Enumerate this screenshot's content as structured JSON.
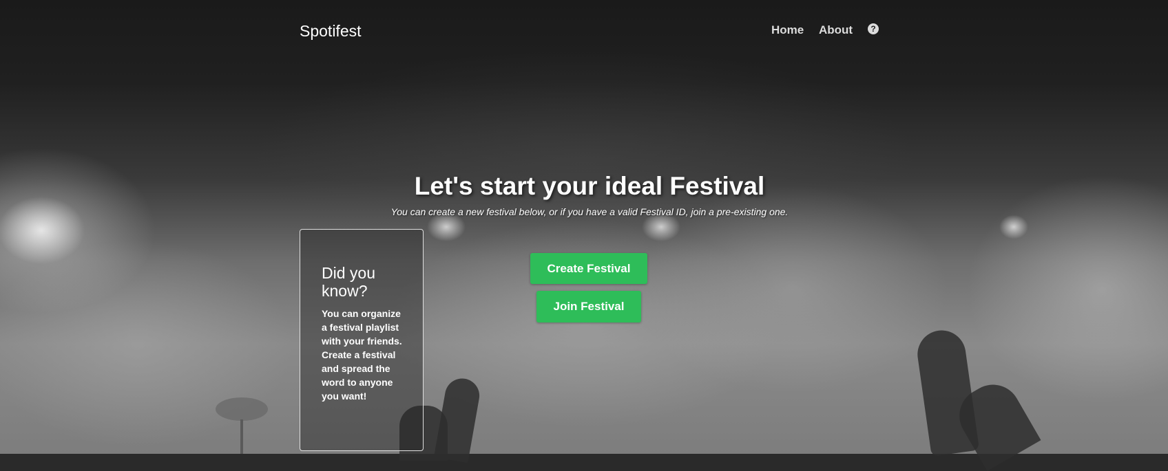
{
  "navbar": {
    "brand": "Spotifest",
    "links": [
      {
        "label": "Home"
      },
      {
        "label": "About"
      }
    ],
    "help_icon": "question-circle-icon",
    "help_glyph": "?"
  },
  "hero": {
    "title": "Let's start your ideal Festival",
    "subtitle": "You can create a new festival below, or if you have a valid Festival ID, join a pre-existing one."
  },
  "did_you_know": {
    "title": "Did you know?",
    "body": "You can organize a festival playlist with your friends. Create a festival and spread the word to anyone you want!"
  },
  "actions": {
    "create_label": "Create Festival",
    "join_label": "Join Festival"
  },
  "colors": {
    "accent": "#2ebd59",
    "text": "#ffffff",
    "nav_link": "#dcdcdc"
  }
}
